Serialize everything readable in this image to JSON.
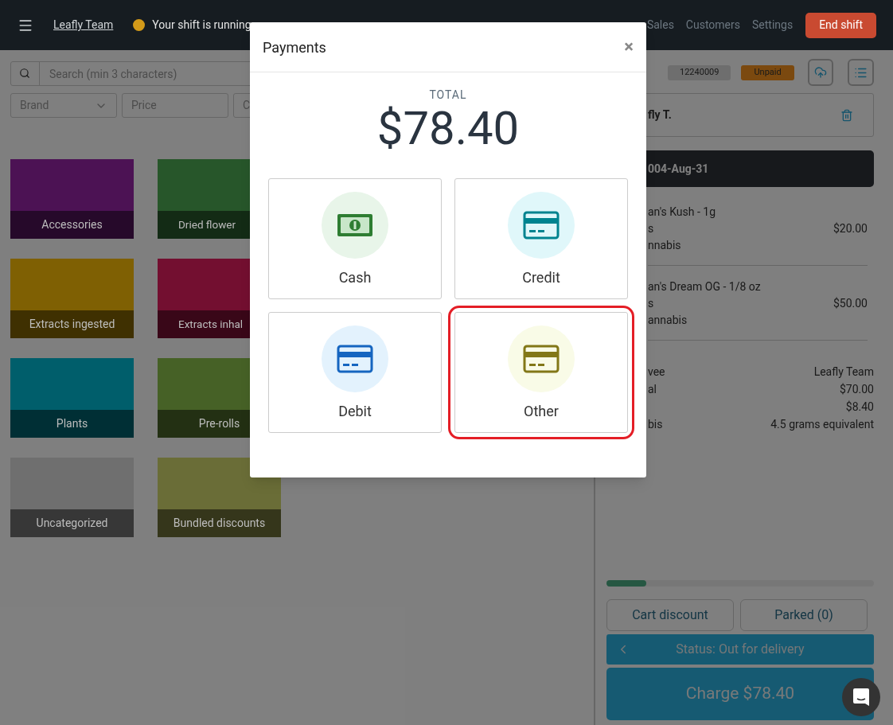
{
  "header": {
    "team": "Leafly Team",
    "notice": "Your shift is running",
    "nav": [
      {
        "label": "Sales"
      },
      {
        "label": "Customers"
      },
      {
        "label": "Settings"
      }
    ],
    "end_shift": "End shift"
  },
  "search": {
    "placeholder": "Search (min 3 characters)"
  },
  "filters": [
    {
      "label": "Brand",
      "kind": "dropdown"
    },
    {
      "label": "Price",
      "kind": "field"
    },
    {
      "label": "C",
      "kind": "field"
    }
  ],
  "categories": [
    {
      "label": "Accessories",
      "color": "#4c1254"
    },
    {
      "label": "Dried flower",
      "color": "#27562a"
    },
    {
      "label": "Extracts ingested",
      "color": "#7f6003"
    },
    {
      "label": "Extracts inhal",
      "color": "#730f30"
    },
    {
      "label": "Plants",
      "color": "#005e6b"
    },
    {
      "label": "Pre-rolls",
      "color": "#466126"
    },
    {
      "label": "Uncategorized",
      "color": "#6f6f6f"
    },
    {
      "label": "Bundled discounts",
      "color": "#6a6d37"
    }
  ],
  "order": {
    "number": "12240009",
    "payment_status": "Unpaid",
    "customer": "fly T.",
    "date": "004-Aug-31",
    "items": [
      {
        "name": "an's Kush - 1g",
        "line_2": "s",
        "price": "$20.00",
        "line_3": "nnabis"
      },
      {
        "name": "an's Dream OG - 1/8 oz",
        "line_2": "s",
        "price": "$50.00",
        "line_3": "annabis"
      }
    ],
    "summary": [
      {
        "label": "vee",
        "value": "Leafly Team"
      },
      {
        "label": "al",
        "value": "$70.00"
      },
      {
        "value": "$8.40"
      },
      {
        "label": "bis",
        "value": "4.5 grams equivalent"
      }
    ],
    "progress": {
      "level": 0.15
    },
    "cart_discount": "Cart discount",
    "parked": "Parked (0)",
    "status": "Status: Out for delivery",
    "charge": "Charge $78.40"
  },
  "modal": {
    "title": "Payments",
    "close": "×",
    "total_label": "TOTAL",
    "total": "$78.40",
    "methods": [
      {
        "label": "Cash",
        "kind": "cash",
        "selected": false
      },
      {
        "label": "Credit",
        "kind": "credit",
        "selected": false
      },
      {
        "label": "Debit",
        "kind": "debit",
        "selected": false
      },
      {
        "label": "Other",
        "kind": "other",
        "selected": true
      }
    ]
  }
}
